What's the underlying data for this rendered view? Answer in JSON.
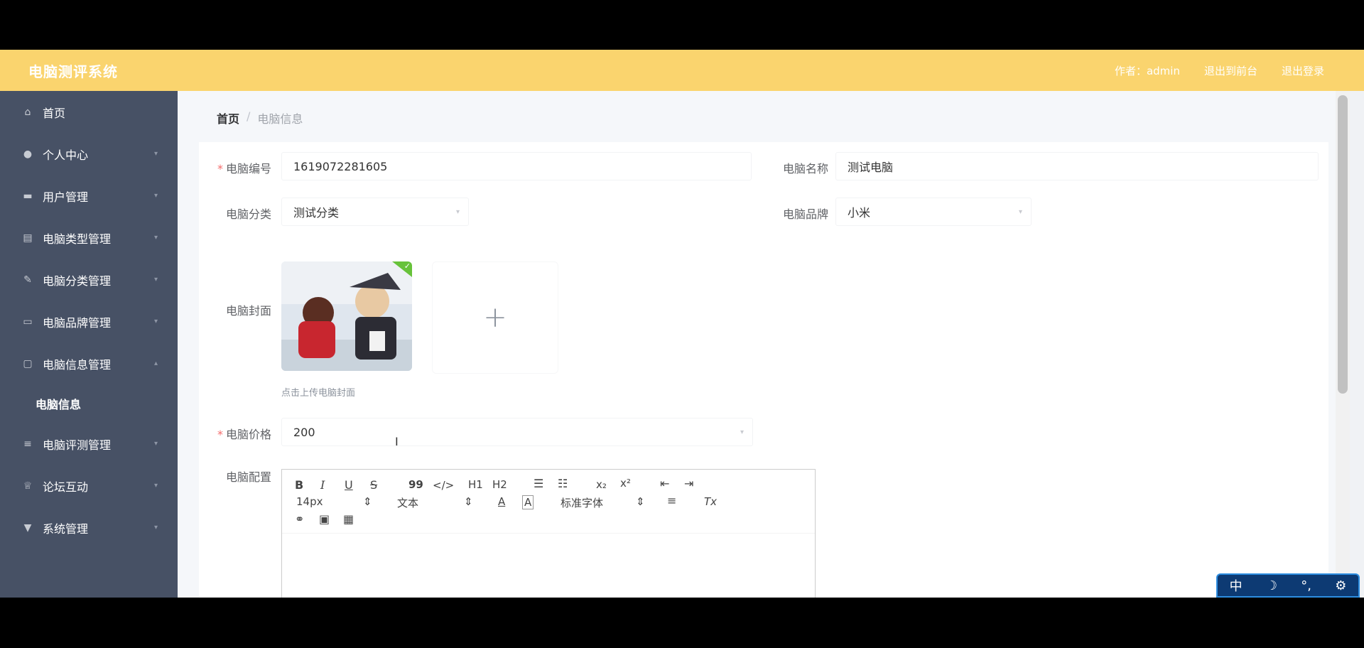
{
  "app": {
    "title": "电脑测评系统"
  },
  "header": {
    "links": [
      "作者：admin",
      "退出到前台",
      "退出登录"
    ]
  },
  "sidebar": {
    "items": [
      {
        "label": "首页",
        "icon": "home-icon"
      },
      {
        "label": "个人中心",
        "icon": "user-icon"
      },
      {
        "label": "用户管理",
        "icon": "chat-icon"
      },
      {
        "label": "电脑类型管理",
        "icon": "list-icon"
      },
      {
        "label": "电脑分类管理",
        "icon": "edit-icon"
      },
      {
        "label": "电脑品牌管理",
        "icon": "card-icon"
      },
      {
        "label": "电脑信息管理",
        "icon": "ticket-icon"
      },
      {
        "label": "电脑评测管理",
        "icon": "menu-icon"
      },
      {
        "label": "论坛互动",
        "icon": "trophy-icon"
      },
      {
        "label": "系统管理",
        "icon": "cup-icon"
      }
    ],
    "submenu": {
      "label": "电脑信息"
    }
  },
  "breadcrumb": {
    "home": "首页",
    "separator": "/",
    "current": "电脑信息"
  },
  "form": {
    "code_label": "电脑编号",
    "code_value": "1619072281605",
    "name_label": "电脑名称",
    "name_value": "测试电脑",
    "category_label": "电脑分类",
    "category_value": "测试分类",
    "brand_label": "电脑品牌",
    "brand_value": "小米",
    "cover_label": "电脑封面",
    "cover_tip": "点击上传电脑封面",
    "price_label": "电脑价格",
    "price_value": "200",
    "config_label": "电脑配置"
  },
  "editor": {
    "bold": "B",
    "italic": "I",
    "underline": "U",
    "strike": "S",
    "quote": "99",
    "code": "</>",
    "h1": "H1",
    "h2": "H2",
    "sub": "x₂",
    "sup": "x²",
    "size": "14px",
    "header": "文本",
    "font": "标准字体",
    "font_color": "A",
    "bg_color": "A",
    "clean": "Tx"
  },
  "ime": {
    "label": "中"
  },
  "colors": {
    "topbar": "#fad46e",
    "sidebar": "#475165",
    "required": "#f56c6c"
  }
}
